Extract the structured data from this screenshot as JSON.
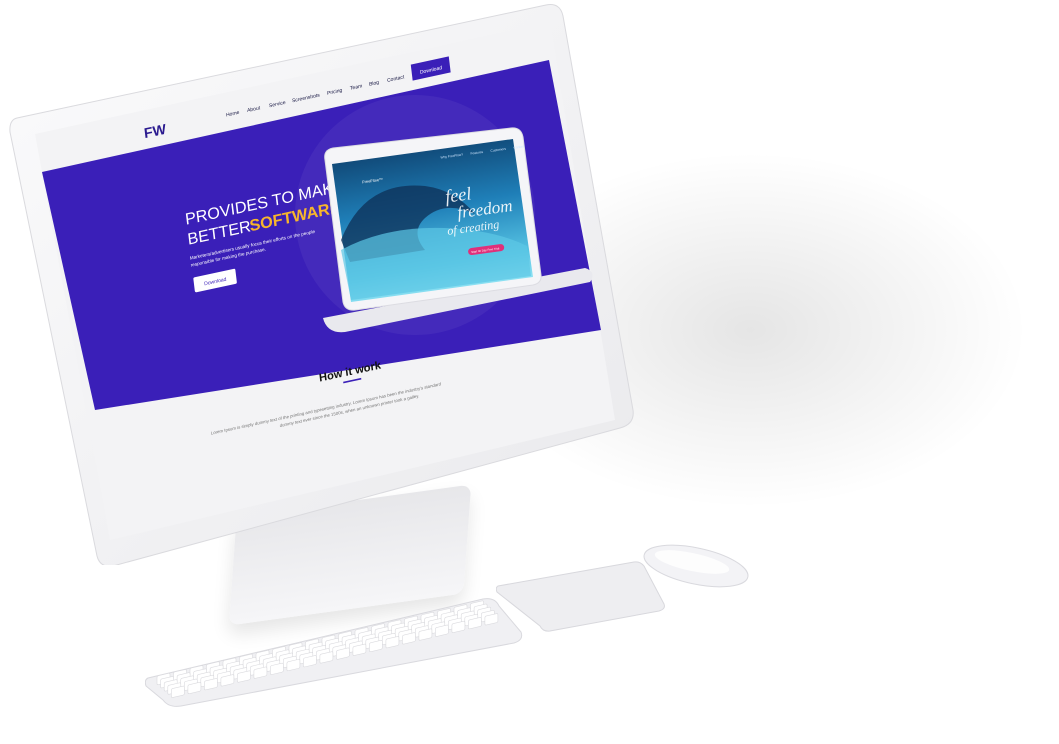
{
  "site": {
    "logo": "FW",
    "nav": {
      "items": [
        "Home",
        "About",
        "Service",
        "Screenshots",
        "Pricing",
        "Team",
        "Blog",
        "Contact"
      ],
      "cta_label": "Download"
    },
    "hero": {
      "headline_line1": "PROVIDES TO MAKE",
      "headline_line2_prefix": "BETTER",
      "headline_line2_highlight": "SOFTWARE",
      "description_line1": "Marketers/advertisers usually focus their efforts on the people",
      "description_line2": "responsible for making the purchase.",
      "button_label": "Download"
    },
    "laptop_screen": {
      "brand": "FreeFlow™",
      "nav_items": [
        "Why FreeFlow?",
        "Features",
        "Customers",
        "Contact"
      ],
      "script_line1": "feel",
      "script_line2": "freedom",
      "script_line3": "of creating",
      "cta_label": "Start 30 Day Free Trial"
    },
    "section": {
      "title": "How it work",
      "text_line1": "Lorem Ipsum is simply dummy text of the printing and typesetting industry. Lorem Ipsum has been the industry's standard",
      "text_line2": "dummy text ever since the 1500s, when an unknown printer took a galley."
    }
  },
  "colors": {
    "brand_purple": "#3a1fb8",
    "accent_yellow": "#f7b52c",
    "cta_pink": "#e0307a",
    "device_white": "#f4f4f6",
    "ocean_blue": "#1e7fb6"
  }
}
